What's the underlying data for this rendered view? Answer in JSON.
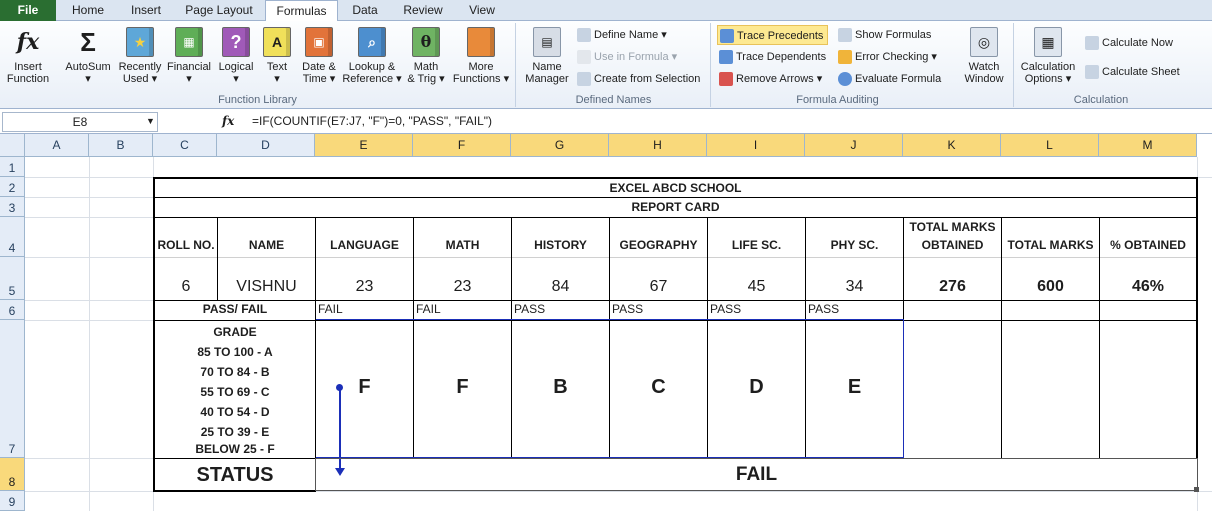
{
  "tabs": [
    "File",
    "Home",
    "Insert",
    "Page Layout",
    "Formulas",
    "Data",
    "Review",
    "View"
  ],
  "ribbon": {
    "function_library": {
      "label": "Function Library",
      "buttons": [
        {
          "l1": "Insert",
          "l2": "Function"
        },
        {
          "l1": "AutoSum",
          "l2": "▾"
        },
        {
          "l1": "Recently",
          "l2": "Used ▾"
        },
        {
          "l1": "Financial",
          "l2": "▾"
        },
        {
          "l1": "Logical",
          "l2": "▾"
        },
        {
          "l1": "Text",
          "l2": "▾"
        },
        {
          "l1": "Date &",
          "l2": "Time ▾"
        },
        {
          "l1": "Lookup &",
          "l2": "Reference ▾"
        },
        {
          "l1": "Math",
          "l2": "& Trig ▾"
        },
        {
          "l1": "More",
          "l2": "Functions ▾"
        }
      ]
    },
    "defined_names": {
      "label": "Defined Names",
      "name_manager": {
        "l1": "Name",
        "l2": "Manager"
      },
      "define_name": "Define Name ▾",
      "use_in_formula": "Use in Formula ▾",
      "create_from_selection": "Create from Selection"
    },
    "formula_auditing": {
      "label": "Formula Auditing",
      "trace_precedents": "Trace Precedents",
      "trace_dependents": "Trace Dependents",
      "remove_arrows": "Remove Arrows ▾",
      "show_formulas": "Show Formulas",
      "error_checking": "Error Checking ▾",
      "evaluate_formula": "Evaluate Formula",
      "watch_window": {
        "l1": "Watch",
        "l2": "Window"
      }
    },
    "calculation": {
      "label": "Calculation",
      "options": {
        "l1": "Calculation",
        "l2": "Options ▾"
      },
      "calc_now": "Calculate Now",
      "calc_sheet": "Calculate Sheet"
    }
  },
  "formula_bar": {
    "name_box": "E8",
    "fx": "fx",
    "formula": "=IF(COUNTIF(E7:J7, \"F\")=0, \"PASS\", \"FAIL\")"
  },
  "columns": [
    "A",
    "B",
    "C",
    "D",
    "E",
    "F",
    "G",
    "H",
    "I",
    "J",
    "K",
    "L",
    "M"
  ],
  "rows": [
    "1",
    "2",
    "3",
    "4",
    "5",
    "6",
    "7",
    "8",
    "9"
  ],
  "sheet": {
    "school": "EXCEL ABCD SCHOOL",
    "report": "REPORT CARD",
    "headers": {
      "roll": "ROLL NO.",
      "name": "NAME",
      "subjects": [
        "LANGUAGE",
        "MATH",
        "HISTORY",
        "GEOGRAPHY",
        "LIFE SC.",
        "PHY SC."
      ],
      "total_obtained_1": "TOTAL MARKS",
      "total_obtained_2": "OBTAINED",
      "total_marks": "TOTAL MARKS",
      "pct": "% OBTAINED"
    },
    "student": {
      "roll": "6",
      "name": "VISHNU",
      "marks": [
        "23",
        "23",
        "84",
        "67",
        "45",
        "34"
      ],
      "total": "276",
      "max": "600",
      "pct": "46%"
    },
    "pass_fail_label": "PASS/ FAIL",
    "pass_fail": [
      "FAIL",
      "FAIL",
      "PASS",
      "PASS",
      "PASS",
      "PASS"
    ],
    "grade_legend": [
      "GRADE",
      "85 TO 100 - A",
      "70 TO 84 - B",
      "55 TO 69 - C",
      "40 TO 54 - D",
      "25 TO 39 - E",
      "BELOW 25 - F"
    ],
    "grades": [
      "F",
      "F",
      "B",
      "C",
      "D",
      "E"
    ],
    "status_label": "STATUS",
    "status": "FAIL"
  }
}
